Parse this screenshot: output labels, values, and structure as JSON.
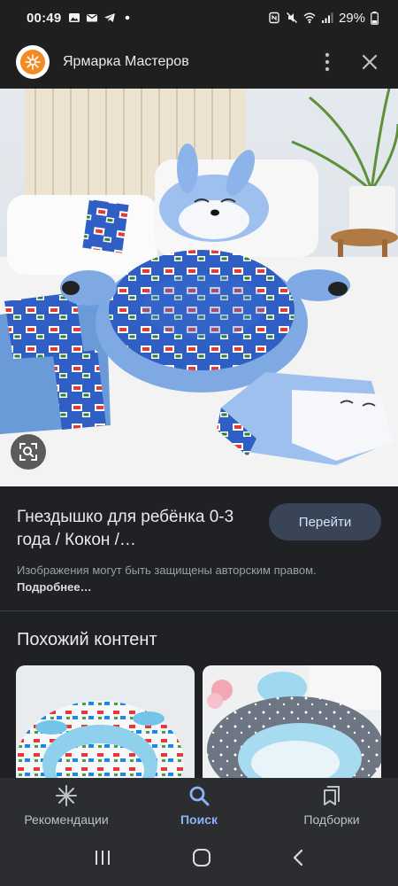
{
  "status_bar": {
    "time": "00:49",
    "left_icons": [
      "gallery-icon",
      "mail-icon",
      "telegram-icon",
      "dot-icon"
    ],
    "right_icons": [
      "nfc-icon",
      "mute-icon",
      "wifi-icon",
      "signal-icon"
    ],
    "battery": "29%"
  },
  "header": {
    "site_name": "Ярмарка Мастеров",
    "logo_icon": "snowflake-logo-icon",
    "menu_icon": "more-vert-icon",
    "close_icon": "close-icon"
  },
  "hero": {
    "lens_icon": "lens-search-icon"
  },
  "result": {
    "title": "Гнездышко для ребёнка 0-3 года / Кокон /…",
    "visit_button": "Перейти",
    "copyright_text": "Изображения могут быть защищены авторским правом.",
    "copyright_more": "Подробнее…"
  },
  "similar": {
    "title": "Похожий контент"
  },
  "bottom_nav": {
    "items": [
      {
        "label": "Рекомендации",
        "icon": "asterisk-icon",
        "active": false
      },
      {
        "label": "Поиск",
        "icon": "search-icon",
        "active": true
      },
      {
        "label": "Подборки",
        "icon": "collections-icon",
        "active": false
      }
    ]
  },
  "colors": {
    "background": "#202124",
    "accent": "#8ab4f8",
    "button": "#394457",
    "logo_orange": "#f28b24"
  }
}
